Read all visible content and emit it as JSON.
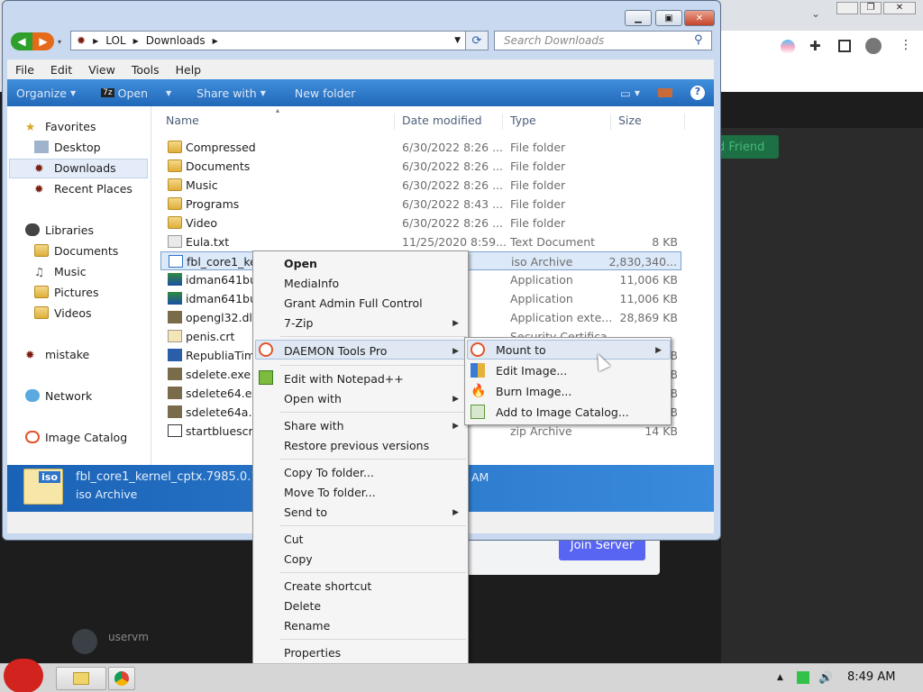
{
  "window": {
    "path": [
      "LOL",
      "Downloads"
    ],
    "search_placeholder": "Search Downloads",
    "menu": [
      "File",
      "Edit",
      "View",
      "Tools",
      "Help"
    ],
    "toolbar": {
      "organize": "Organize",
      "open": "Open",
      "share": "Share with",
      "new_folder": "New folder"
    }
  },
  "navpane": {
    "favorites": "Favorites",
    "desktop": "Desktop",
    "downloads": "Downloads",
    "recent": "Recent Places",
    "libraries": "Libraries",
    "documents": "Documents",
    "music": "Music",
    "pictures": "Pictures",
    "videos": "Videos",
    "mistake": "mistake",
    "network": "Network",
    "image_catalog": "Image Catalog"
  },
  "columns": {
    "name": "Name",
    "date": "Date modified",
    "type": "Type",
    "size": "Size"
  },
  "files": [
    {
      "name": "Compressed",
      "date": "6/30/2022 8:26 ...",
      "type": "File folder",
      "size": ""
    },
    {
      "name": "Documents",
      "date": "6/30/2022 8:26 ...",
      "type": "File folder",
      "size": ""
    },
    {
      "name": "Music",
      "date": "6/30/2022 8:26 ...",
      "type": "File folder",
      "size": ""
    },
    {
      "name": "Programs",
      "date": "6/30/2022 8:43 ...",
      "type": "File folder",
      "size": ""
    },
    {
      "name": "Video",
      "date": "6/30/2022 8:26 ...",
      "type": "File folder",
      "size": ""
    },
    {
      "name": "Eula.txt",
      "date": "11/25/2020 8:59...",
      "type": "Text Document",
      "size": "8 KB"
    },
    {
      "name": "fbl_core1_ke",
      "date": "48 ...",
      "type": "iso Archive",
      "size": "2,830,340..."
    },
    {
      "name": "idman641bu",
      "date": "25 ...",
      "type": "Application",
      "size": "11,006 KB"
    },
    {
      "name": "idman641bu",
      "date": "25 ...",
      "type": "Application",
      "size": "11,006 KB"
    },
    {
      "name": "opengl32.dll",
      "date": "38 ...",
      "type": "Application exte...",
      "size": "28,869 KB"
    },
    {
      "name": "penis.crt",
      "date": "",
      "type": "Security Certifica",
      "size": ""
    },
    {
      "name": "RepubliaTim",
      "date": "",
      "type": "",
      "size": "KB"
    },
    {
      "name": "sdelete.exe",
      "date": "",
      "type": "",
      "size": "KB"
    },
    {
      "name": "sdelete64.ex",
      "date": "",
      "type": "",
      "size": "KB"
    },
    {
      "name": "sdelete64a.e",
      "date": "",
      "type": "",
      "size": "KB"
    },
    {
      "name": "startbluescre",
      "date": "12 ...",
      "type": "zip Archive",
      "size": "14 KB"
    }
  ],
  "details": {
    "filename": "fbl_core1_kernel_cptx.7985.0.11",
    "filetype": "iso Archive",
    "tail": "AM",
    "iso_badge": "iso"
  },
  "context_menu": {
    "open": "Open",
    "mediainfo": "MediaInfo",
    "grant": "Grant Admin Full Control",
    "zip": "7-Zip",
    "daemon": "DAEMON Tools Pro",
    "notepad": "Edit with Notepad++",
    "open_with": "Open with",
    "share_with": "Share with",
    "restore": "Restore previous versions",
    "copy_to": "Copy To folder...",
    "move_to": "Move To folder...",
    "send_to": "Send to",
    "cut": "Cut",
    "copy": "Copy",
    "create_shortcut": "Create shortcut",
    "delete": "Delete",
    "rename": "Rename",
    "properties": "Properties"
  },
  "submenu": {
    "mount": "Mount to",
    "edit": "Edit Image...",
    "burn": "Burn Image...",
    "add": "Add to Image Catalog..."
  },
  "background": {
    "add_friend": "d Friend",
    "join": "Join Server",
    "user": "uservm"
  },
  "taskbar": {
    "time": "8:49 AM"
  }
}
